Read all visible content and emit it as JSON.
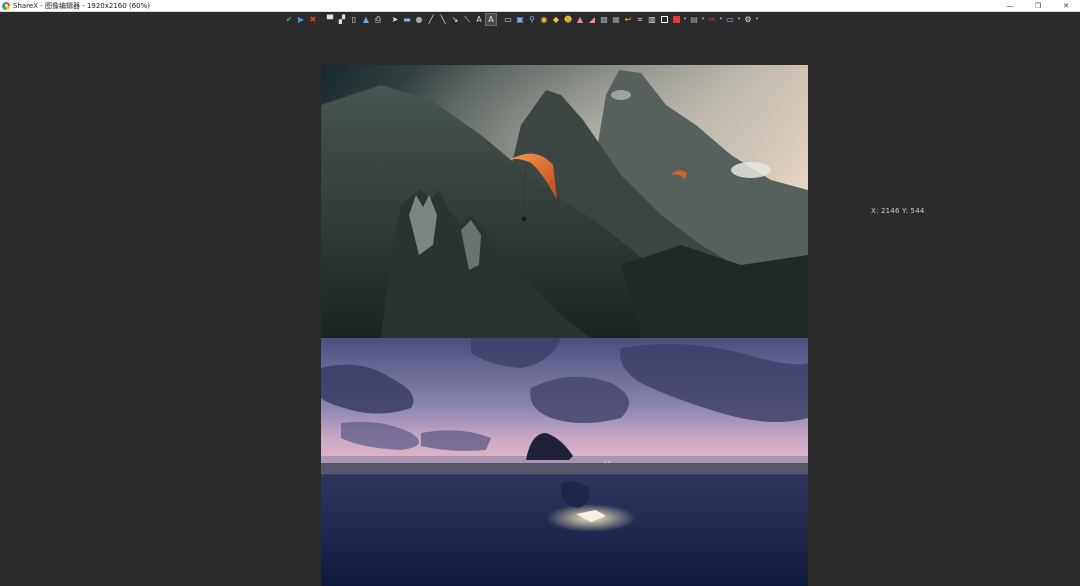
{
  "window": {
    "title": "ShareX - 图像编辑器 - 1920x2160 (60%)",
    "minimize": "—",
    "maximize": "❐",
    "close": "✕"
  },
  "toolbar": {
    "items": [
      {
        "icon": "check-icon",
        "glyph": "✔",
        "color": "#3cba54"
      },
      {
        "icon": "run-icon",
        "glyph": "▶",
        "color": "#4a90e2"
      },
      {
        "icon": "close-red-icon",
        "glyph": "✖",
        "color": "#e53935"
      },
      {
        "icon": "save-icon",
        "glyph": "▀",
        "color": "#e0e0e0"
      },
      {
        "icon": "save-as-icon",
        "glyph": "▞",
        "color": "#e0e0e0"
      },
      {
        "icon": "copy-icon",
        "glyph": "▯",
        "color": "#e0e0e0"
      },
      {
        "icon": "upload-icon",
        "glyph": "▲",
        "color": "#6fa8dc"
      },
      {
        "icon": "print-icon",
        "glyph": "⎙",
        "color": "#e0e0e0"
      },
      {
        "icon": "cursor-icon",
        "glyph": "➤",
        "color": "#e0e0e0"
      },
      {
        "icon": "rectangle-icon",
        "glyph": "▬",
        "color": "#8ab4f8"
      },
      {
        "icon": "ellipse-icon",
        "glyph": "●",
        "color": "#9aa7b3"
      },
      {
        "icon": "pen-icon",
        "glyph": "╱",
        "color": "#e0e0e0"
      },
      {
        "icon": "line-icon",
        "glyph": "╲",
        "color": "#e0e0e0"
      },
      {
        "icon": "arrow-icon",
        "glyph": "↘",
        "color": "#e0e0e0"
      },
      {
        "icon": "curve-icon",
        "glyph": "⟍",
        "color": "#e0e0e0"
      },
      {
        "icon": "text-outline-icon",
        "glyph": "A",
        "color": "#e0e0e0"
      },
      {
        "icon": "text-background-icon",
        "glyph": "A",
        "color": "#e0e0e0",
        "selected": true
      },
      {
        "icon": "speech-balloon-icon",
        "glyph": "▭",
        "color": "#e0e0e0"
      },
      {
        "icon": "step-icon",
        "glyph": "▣",
        "color": "#8ab4f8"
      },
      {
        "icon": "magnify-icon",
        "glyph": "⚲",
        "color": "#8ab4f8"
      },
      {
        "icon": "sticker-icon",
        "glyph": "◉",
        "color": "#f4c542"
      },
      {
        "icon": "cursor-sticker-icon",
        "glyph": "◆",
        "color": "#f4c542"
      },
      {
        "icon": "emoji-icon",
        "glyph": "☻",
        "color": "#f4c542"
      },
      {
        "icon": "smart-eraser-icon",
        "glyph": "▲",
        "color": "#f28b82"
      },
      {
        "icon": "eraser-icon",
        "glyph": "◢",
        "color": "#f28b82"
      },
      {
        "icon": "blur-icon",
        "glyph": "▩",
        "color": "#9e9e9e"
      },
      {
        "icon": "pixelate-icon",
        "glyph": "▦",
        "color": "#9e9e9e"
      },
      {
        "icon": "highlight-icon",
        "glyph": "↩",
        "color": "#fbbc04"
      },
      {
        "icon": "crop-icon",
        "glyph": "⌗",
        "color": "#e0e0e0"
      },
      {
        "icon": "cut-icon",
        "glyph": "▥",
        "color": "#e0e0e0"
      },
      {
        "icon": "border-color-icon",
        "glyph": "",
        "color": "#ffffff"
      },
      {
        "icon": "fill-color-icon",
        "glyph": "",
        "color": "#e53935"
      },
      {
        "icon": "image-icon",
        "glyph": "▤",
        "color": "#9aa7b3"
      },
      {
        "icon": "effects-icon",
        "glyph": "✂",
        "color": "#e53935"
      },
      {
        "icon": "edit-icon",
        "glyph": "▭",
        "color": "#8ab4f8"
      },
      {
        "icon": "settings-icon",
        "glyph": "⚙",
        "color": "#e0e0e0"
      }
    ]
  },
  "status": {
    "coordinates": "X: 2146 Y: 544"
  }
}
